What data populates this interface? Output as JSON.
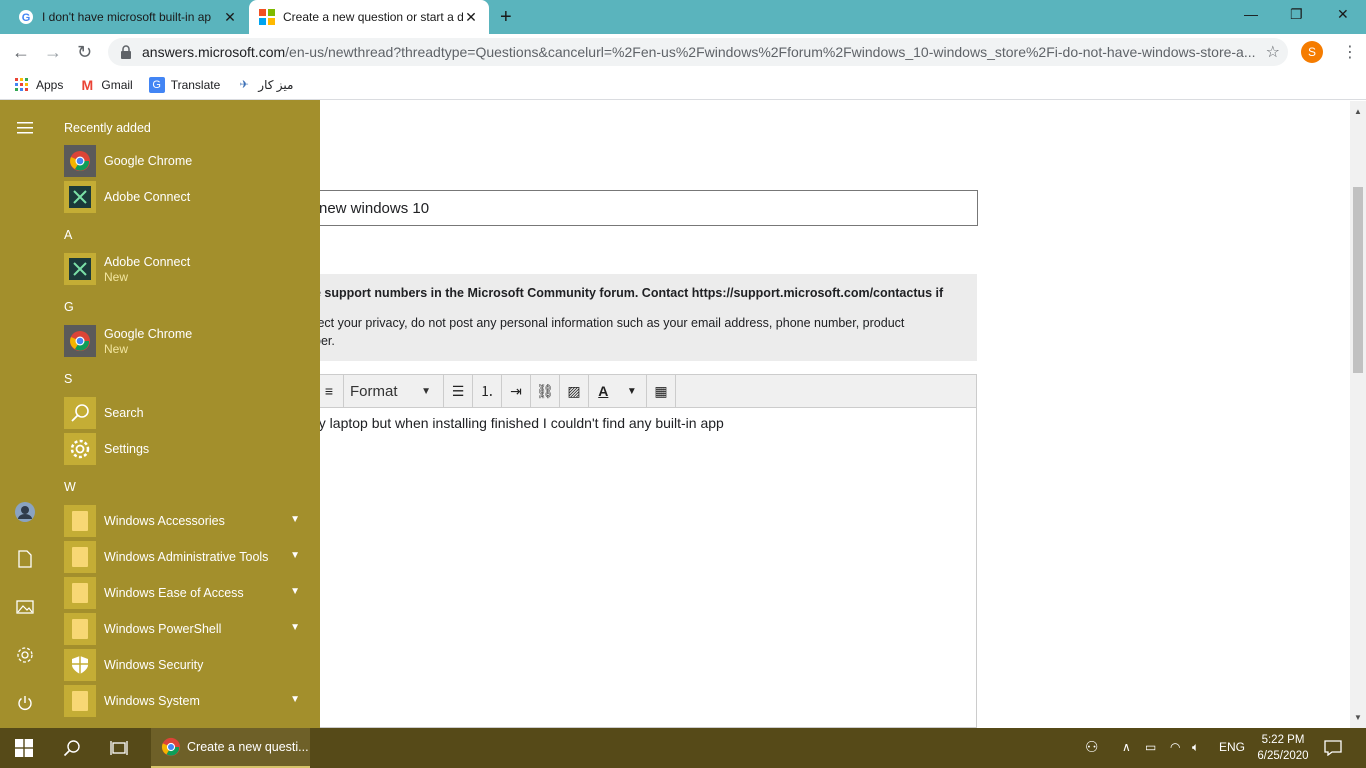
{
  "browser": {
    "tabs": [
      {
        "title": "I don't have microsoft built-in ap",
        "active": false
      },
      {
        "title": "Create a new question or start a d",
        "active": true
      }
    ],
    "url_domain": "answers.microsoft.com",
    "url_rest": "/en-us/newthread?threadtype=Questions&cancelurl=%2Fen-us%2Fwindows%2Fforum%2Fwindows_10-windows_store%2Fi-do-not-have-windows-store-a...",
    "profile_initial": "S",
    "bookmarks": [
      "Apps",
      "Gmail",
      "Translate",
      "میز کار"
    ]
  },
  "page": {
    "subject_value": "new windows 10",
    "notice_line1": "e support numbers in the Microsoft Community forum. Contact https://support.microsoft.com/contactus if",
    "notice_line2": "tect your privacy, do not post any personal information such as your email address, phone number, product",
    "notice_line3": "ber.",
    "format_label": "Format",
    "editor_text": "ny laptop but when installing finished I couldn't find any built-in app"
  },
  "start_menu": {
    "recently_added_label": "Recently added",
    "recent": [
      "Google Chrome",
      "Adobe Connect"
    ],
    "groups": [
      {
        "letter": "A",
        "items": [
          {
            "name": "Adobe Connect",
            "sub": "New"
          }
        ]
      },
      {
        "letter": "G",
        "items": [
          {
            "name": "Google Chrome",
            "sub": "New"
          }
        ]
      },
      {
        "letter": "S",
        "items": [
          {
            "name": "Search"
          },
          {
            "name": "Settings"
          }
        ]
      },
      {
        "letter": "W",
        "items": [
          {
            "name": "Windows Accessories"
          },
          {
            "name": "Windows Administrative Tools"
          },
          {
            "name": "Windows Ease of Access"
          },
          {
            "name": "Windows PowerShell"
          },
          {
            "name": "Windows Security"
          },
          {
            "name": "Windows System"
          }
        ]
      }
    ]
  },
  "taskbar": {
    "app_label": "Create a new questi...",
    "language": "ENG",
    "time": "5:22 PM",
    "date": "6/25/2020"
  },
  "colors": {
    "accent": "#a38f2c",
    "taskbar": "#564a18",
    "tab_strip": "#5ab4bd"
  }
}
